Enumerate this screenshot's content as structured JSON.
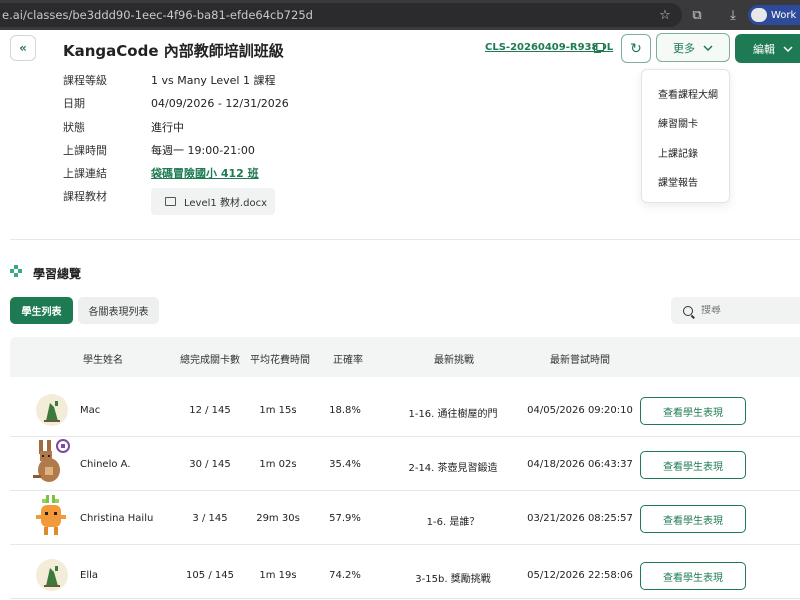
{
  "browser": {
    "url": "e.ai/classes/be3ddd90-1eec-4f96-ba81-efde64cb725d",
    "profile_label": "Work"
  },
  "header": {
    "title": "KangaCode 內部教師培訓班級",
    "class_code": "CLS-20260409-R938DL",
    "more_label": "更多",
    "edit_label": "編輯"
  },
  "info": {
    "rows": [
      {
        "label": "課程等級",
        "value": "1 vs Many Level 1 課程"
      },
      {
        "label": "日期",
        "value": "04/09/2026 - 12/31/2026"
      },
      {
        "label": "狀態",
        "value": "進行中"
      },
      {
        "label": "上課時間",
        "value": "每週一 19:00-21:00"
      },
      {
        "label": "上課連結",
        "value": "袋碼冒險國小 412 班"
      },
      {
        "label": "課程教材",
        "value": ""
      }
    ],
    "material_file": "Level1 教材.docx"
  },
  "dropdown": {
    "items": [
      "查看課程大綱",
      "練習關卡",
      "上課記錄",
      "課堂報告"
    ]
  },
  "section": {
    "title": "學習總覽"
  },
  "tabs": {
    "student_list": "學生列表",
    "level_list": "各關表現列表"
  },
  "search": {
    "placeholder": "搜尋"
  },
  "table": {
    "headers": [
      "學生姓名",
      "總完成關卡數",
      "平均花費時間",
      "正確率",
      "最新挑戰",
      "最新嘗試時間"
    ],
    "button_label": "查看學生表現",
    "rows": [
      {
        "name": "Mac",
        "completed": "12 / 145",
        "avg_time": "1m 15s",
        "accuracy": "18.8%",
        "latest": "1-16. 通往樹屋的門",
        "last_attempt": "04/05/2026 09:20:10",
        "avatar": "green-plant-avatar"
      },
      {
        "name": "Chinelo A.",
        "completed": "30 / 145",
        "avg_time": "1m 02s",
        "accuracy": "35.4%",
        "latest": "2-14. 茶壺見習鍛造",
        "last_attempt": "04/18/2026 06:43:37",
        "avatar": "kangaroo-avatar"
      },
      {
        "name": "Christina Hailu",
        "completed": "3 / 145",
        "avg_time": "29m 30s",
        "accuracy": "57.9%",
        "latest": "1-6. 是誰？",
        "last_attempt": "03/21/2026 08:25:57",
        "avatar": "carrot-avatar"
      },
      {
        "name": "Ella",
        "completed": "105 / 145",
        "avg_time": "1m 19s",
        "accuracy": "74.2%",
        "latest": "3-15b. 獎勵挑戰",
        "last_attempt": "05/12/2026 22:58:06",
        "avatar": "green-plant-avatar"
      }
    ]
  }
}
